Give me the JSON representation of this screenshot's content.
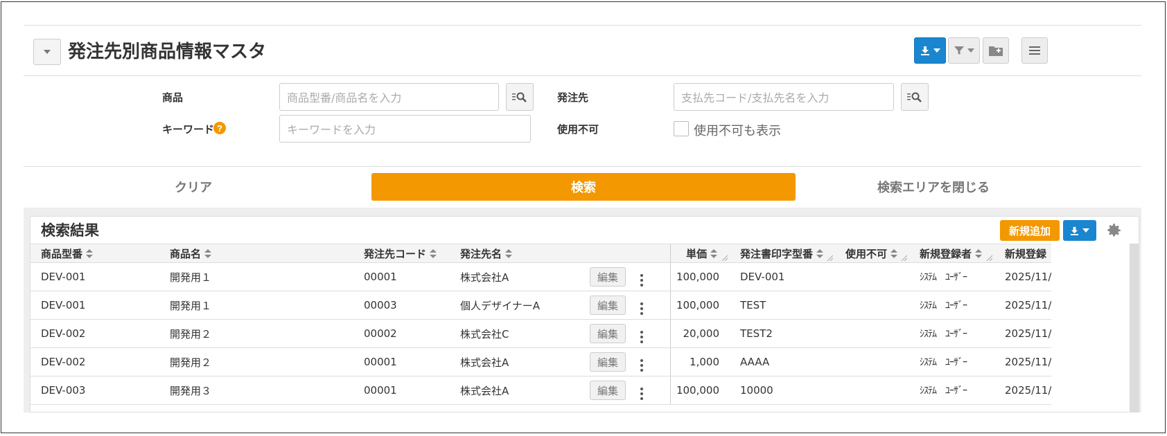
{
  "header": {
    "title": "発注先別商品情報マスタ"
  },
  "search": {
    "product_label": "商品",
    "product_placeholder": "商品型番/商品名を入力",
    "supplier_label": "発注先",
    "supplier_placeholder": "支払先コード/支払先名を入力",
    "keyword_label": "キーワード",
    "keyword_help": "?",
    "keyword_placeholder": "キーワードを入力",
    "unavailable_label": "使用不可",
    "unavailable_checkbox_label": "使用不可も表示",
    "clear_label": "クリア",
    "search_label": "検索",
    "close_label": "検索エリアを閉じる"
  },
  "results": {
    "title": "検索結果",
    "new_label": "新規追加",
    "columns": [
      "商品型番",
      "商品名",
      "発注先コード",
      "発注先名",
      "単価",
      "発注書印字型番",
      "使用不可",
      "新規登録者",
      "新規登録"
    ],
    "edit_label": "編集",
    "rows": [
      {
        "code": "DEV-001",
        "name": "開発用１",
        "supplier_code": "00001",
        "supplier_name": "株式会社A",
        "price": "100,000",
        "print_code": "DEV-001",
        "disabled": "",
        "creator": "ｼｽﾃﾑ　ﾕｰｻﾞｰ",
        "created": "2025/11/"
      },
      {
        "code": "DEV-001",
        "name": "開発用１",
        "supplier_code": "00003",
        "supplier_name": "個人デザイナーA",
        "price": "100,000",
        "print_code": "TEST",
        "disabled": "",
        "creator": "ｼｽﾃﾑ　ﾕｰｻﾞｰ",
        "created": "2025/11/"
      },
      {
        "code": "DEV-002",
        "name": "開発用２",
        "supplier_code": "00002",
        "supplier_name": "株式会社C",
        "price": "20,000",
        "print_code": "TEST2",
        "disabled": "",
        "creator": "ｼｽﾃﾑ　ﾕｰｻﾞｰ",
        "created": "2025/11/"
      },
      {
        "code": "DEV-002",
        "name": "開発用２",
        "supplier_code": "00001",
        "supplier_name": "株式会社A",
        "price": "1,000",
        "print_code": "AAAA",
        "disabled": "",
        "creator": "ｼｽﾃﾑ　ﾕｰｻﾞｰ",
        "created": "2025/11/"
      },
      {
        "code": "DEV-003",
        "name": "開発用３",
        "supplier_code": "00001",
        "supplier_name": "株式会社A",
        "price": "100,000",
        "print_code": "10000",
        "disabled": "",
        "creator": "ｼｽﾃﾑ　ﾕｰｻﾞｰ",
        "created": "2025/11/"
      }
    ]
  },
  "colors": {
    "accent_orange": "#f39800",
    "primary_blue": "#1a86d0"
  },
  "icons": {
    "collapse": "chevron-down-icon",
    "download": "download-icon",
    "filter": "filter-icon",
    "folder": "folder-add-icon",
    "menu": "hamburger-menu-icon",
    "search": "search-list-icon",
    "settings": "gear-icon",
    "row_menu": "kebab-menu-icon"
  }
}
